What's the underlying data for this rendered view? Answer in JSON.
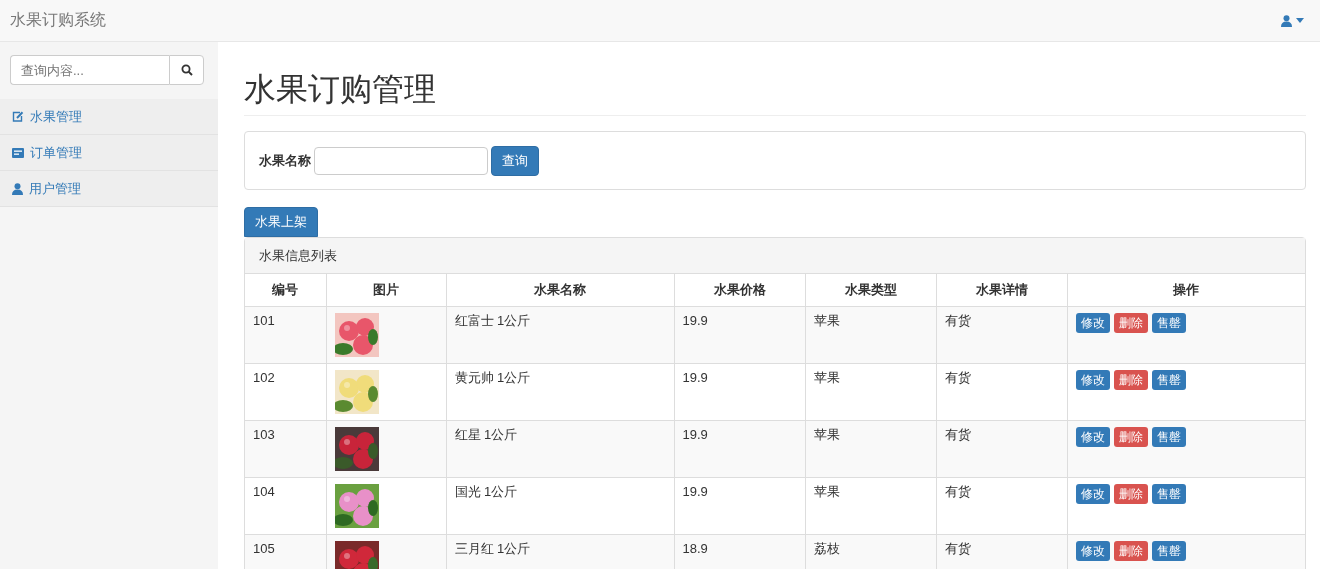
{
  "navbar": {
    "brand": "水果订购系统"
  },
  "sidebar": {
    "search": {
      "placeholder": "查询内容..."
    },
    "items": [
      {
        "kind": "edit",
        "label": "水果管理"
      },
      {
        "kind": "list",
        "label": "订单管理"
      },
      {
        "kind": "user",
        "label": "用户管理"
      }
    ]
  },
  "page": {
    "title": "水果订购管理"
  },
  "filter": {
    "label": "水果名称",
    "button": "查询"
  },
  "add_button": "水果上架",
  "table": {
    "heading": "水果信息列表",
    "columns": [
      "编号",
      "图片",
      "水果名称",
      "水果价格",
      "水果类型",
      "水果详情",
      "操作"
    ],
    "rows": [
      {
        "id": "101",
        "name": "红富士 1公斤",
        "price": "19.9",
        "type": "苹果",
        "detail": "有货",
        "actions": [
          {
            "kind": "edit",
            "label": "修改"
          },
          {
            "kind": "delete",
            "label": "删除"
          },
          {
            "kind": "soldout",
            "label": "售罄"
          }
        ]
      },
      {
        "id": "102",
        "name": "黄元帅 1公斤",
        "price": "19.9",
        "type": "苹果",
        "detail": "有货",
        "actions": [
          {
            "kind": "edit",
            "label": "修改"
          },
          {
            "kind": "delete",
            "label": "删除"
          },
          {
            "kind": "soldout",
            "label": "售罄"
          }
        ]
      },
      {
        "id": "103",
        "name": "红星 1公斤",
        "price": "19.9",
        "type": "苹果",
        "detail": "有货",
        "actions": [
          {
            "kind": "edit",
            "label": "修改"
          },
          {
            "kind": "delete",
            "label": "删除"
          },
          {
            "kind": "soldout",
            "label": "售罄"
          }
        ]
      },
      {
        "id": "104",
        "name": "国光 1公斤",
        "price": "19.9",
        "type": "苹果",
        "detail": "有货",
        "actions": [
          {
            "kind": "edit",
            "label": "修改"
          },
          {
            "kind": "delete",
            "label": "删除"
          },
          {
            "kind": "soldout",
            "label": "售罄"
          }
        ]
      },
      {
        "id": "105",
        "name": "三月红 1公斤",
        "price": "18.9",
        "type": "荔枝",
        "detail": "有货",
        "actions": [
          {
            "kind": "edit",
            "label": "修改"
          },
          {
            "kind": "delete",
            "label": "删除"
          },
          {
            "kind": "soldout",
            "label": "售罄"
          }
        ]
      }
    ]
  }
}
